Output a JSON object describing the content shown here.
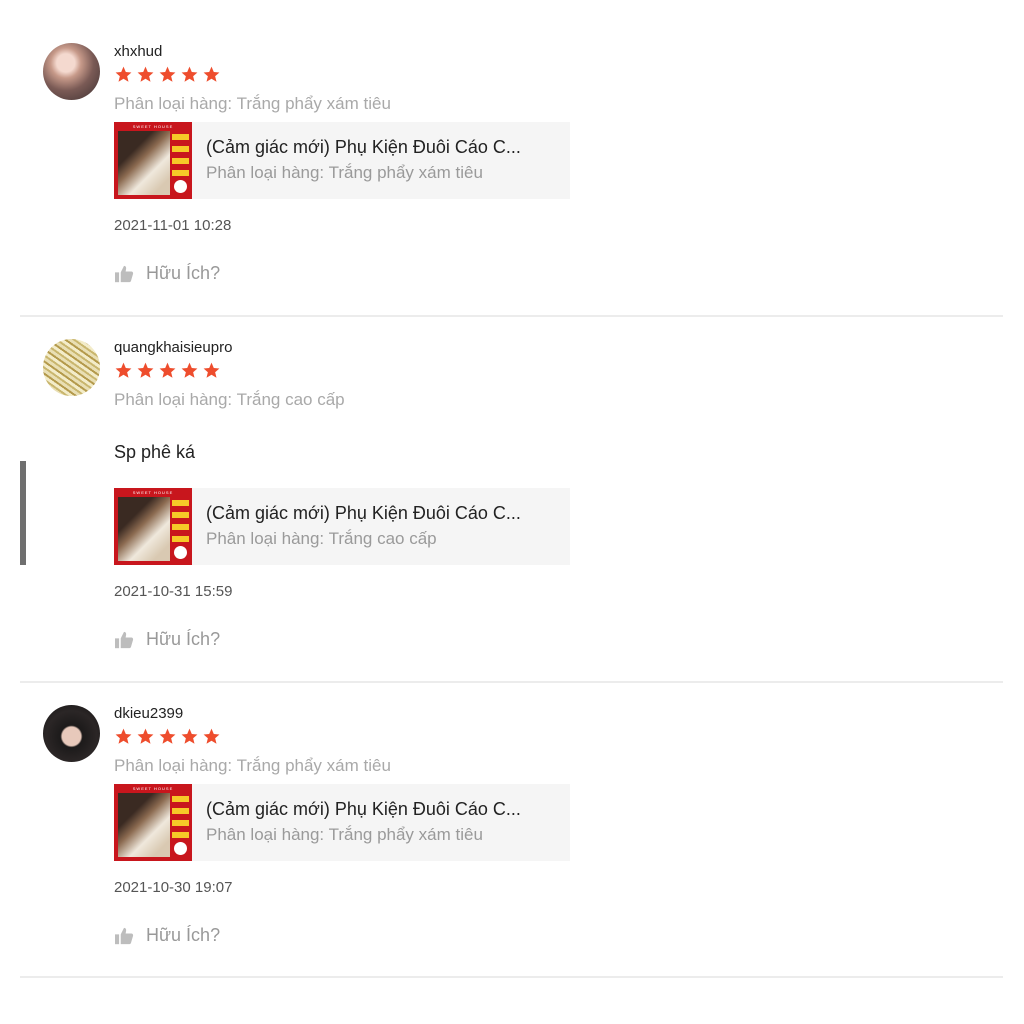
{
  "reviews": [
    {
      "username": "xhxhud",
      "rating": 5,
      "variation": "Phân loại hàng: Trắng phẩy xám tiêu",
      "comment": "",
      "product": {
        "title": "(Cảm giác mới) Phụ Kiện Đuôi Cáo C...",
        "variation": "Phân loại hàng: Trắng phẩy xám tiêu",
        "thumb_label": "SWEET HOUSE"
      },
      "timestamp": "2021-11-01 10:28",
      "helpful_label": "Hữu Ích?"
    },
    {
      "username": "quangkhaisieupro",
      "rating": 5,
      "variation": "Phân loại hàng: Trắng cao cấp",
      "comment": "Sp phê ká",
      "product": {
        "title": "(Cảm giác mới) Phụ Kiện Đuôi Cáo C...",
        "variation": "Phân loại hàng: Trắng cao cấp",
        "thumb_label": "SWEET HOUSE"
      },
      "timestamp": "2021-10-31 15:59",
      "helpful_label": "Hữu Ích?"
    },
    {
      "username": "dkieu2399",
      "rating": 5,
      "variation": "Phân loại hàng: Trắng phẩy xám tiêu",
      "comment": "",
      "product": {
        "title": "(Cảm giác mới) Phụ Kiện Đuôi Cáo C...",
        "variation": "Phân loại hàng: Trắng phẩy xám tiêu",
        "thumb_label": "SWEET HOUSE"
      },
      "timestamp": "2021-10-30 19:07",
      "helpful_label": "Hữu Ích?"
    }
  ],
  "colors": {
    "star": "#ee4d2d",
    "thumb_bg": "#c8161d",
    "muted_text": "#a9a9a9"
  },
  "icons": {
    "star": "star-icon",
    "helpful": "thumbs-up-icon"
  }
}
